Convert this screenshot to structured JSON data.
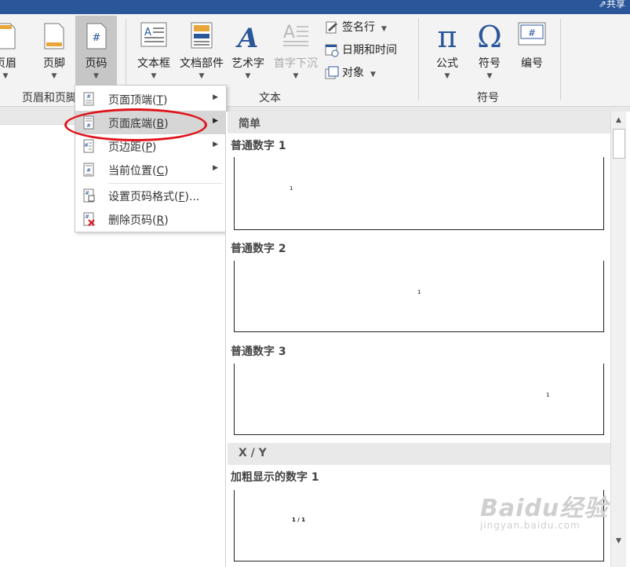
{
  "header": {
    "share_label": "共享"
  },
  "ribbon": {
    "groups": {
      "header_footer": "页眉和页脚",
      "text": "文本",
      "symbols": "符号"
    },
    "buttons": {
      "header": "页眉",
      "footer": "页脚",
      "page_number": "页码",
      "textbox": "文本框",
      "quick_parts": "文档部件",
      "wordart": "艺术字",
      "dropcap": "首字下沉",
      "equation": "公式",
      "symbol": "符号",
      "number": "编号",
      "signature_line": "签名行",
      "date_time": "日期和时间",
      "object": "对象"
    }
  },
  "menu": {
    "items": [
      {
        "label": "页面顶端",
        "accel": "T",
        "has_submenu": true
      },
      {
        "label": "页面底端",
        "accel": "B",
        "has_submenu": true,
        "highlighted": true
      },
      {
        "label": "页边距",
        "accel": "P",
        "has_submenu": true
      },
      {
        "label": "当前位置",
        "accel": "C",
        "has_submenu": true
      },
      {
        "label": "设置页码格式",
        "accel": "F",
        "suffix": "...",
        "has_submenu": false
      },
      {
        "label": "删除页码",
        "accel": "R",
        "has_submenu": false
      }
    ]
  },
  "gallery": {
    "sections": [
      {
        "title": "简单"
      },
      {
        "title": "X / Y"
      }
    ],
    "items": [
      {
        "title": "普通数字 1",
        "sample": "1"
      },
      {
        "title": "普通数字 2",
        "sample": "1"
      },
      {
        "title": "普通数字 3",
        "sample": "1"
      },
      {
        "title": "加粗显示的数字 1",
        "sample": "1 / 1"
      }
    ]
  },
  "watermark": {
    "brand": "Baidu经验",
    "url": "jingyan.baidu.com"
  },
  "colors": {
    "title_bar": "#2b579a",
    "highlight_ring": "#e0131a",
    "icon_blue": "#2b579a",
    "icon_orange": "#e8a53a"
  }
}
